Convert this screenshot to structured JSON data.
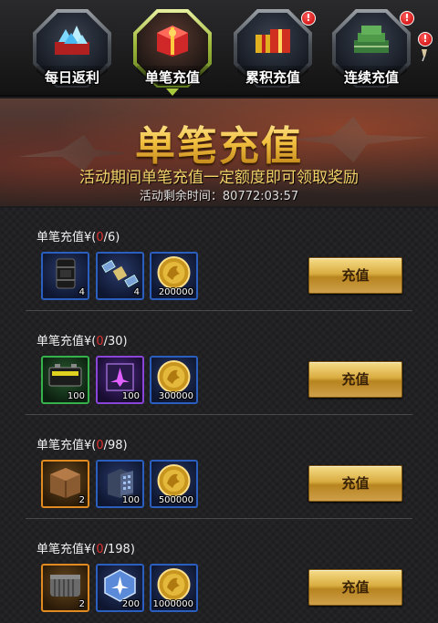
{
  "tabs": [
    {
      "label": "每日返利",
      "badge": ""
    },
    {
      "label": "单笔充值",
      "badge": ""
    },
    {
      "label": "累积充值",
      "badge": "!"
    },
    {
      "label": "连续充值",
      "badge": "!"
    }
  ],
  "extra_badge": "!",
  "banner": {
    "title": "单笔充值",
    "subtitle": "活动期间单笔充值一定额度即可领取奖励",
    "timer_label": "活动剩余时间：",
    "timer_value": "80772:03:57"
  },
  "tiers": [
    {
      "prefix": "单笔充值¥(",
      "current": "0",
      "suffix": "/6)",
      "button": "充值",
      "items": [
        {
          "icon": "oil-barrel-icon",
          "qty": "4"
        },
        {
          "icon": "satellite-icon",
          "qty": "4"
        },
        {
          "icon": "gold-coin-icon",
          "qty": "200000"
        }
      ]
    },
    {
      "prefix": "单笔充值¥(",
      "current": "0",
      "suffix": "/30)",
      "button": "充值",
      "items": [
        {
          "icon": "battery-icon",
          "qty": "100"
        },
        {
          "icon": "fighter-chip-icon",
          "qty": "100"
        },
        {
          "icon": "gold-coin-icon",
          "qty": "300000"
        }
      ]
    },
    {
      "prefix": "单笔充值¥(",
      "current": "0",
      "suffix": "/98)",
      "button": "充值",
      "items": [
        {
          "icon": "supply-crate-icon",
          "qty": "2"
        },
        {
          "icon": "building-icon",
          "qty": "100"
        },
        {
          "icon": "gold-coin-icon",
          "qty": "500000"
        }
      ]
    },
    {
      "prefix": "单笔充值¥(",
      "current": "0",
      "suffix": "/198)",
      "button": "充值",
      "items": [
        {
          "icon": "cargo-container-icon",
          "qty": "2"
        },
        {
          "icon": "aircraft-badge-icon",
          "qty": "200"
        },
        {
          "icon": "gold-coin-icon",
          "qty": "1000000"
        }
      ]
    }
  ]
}
